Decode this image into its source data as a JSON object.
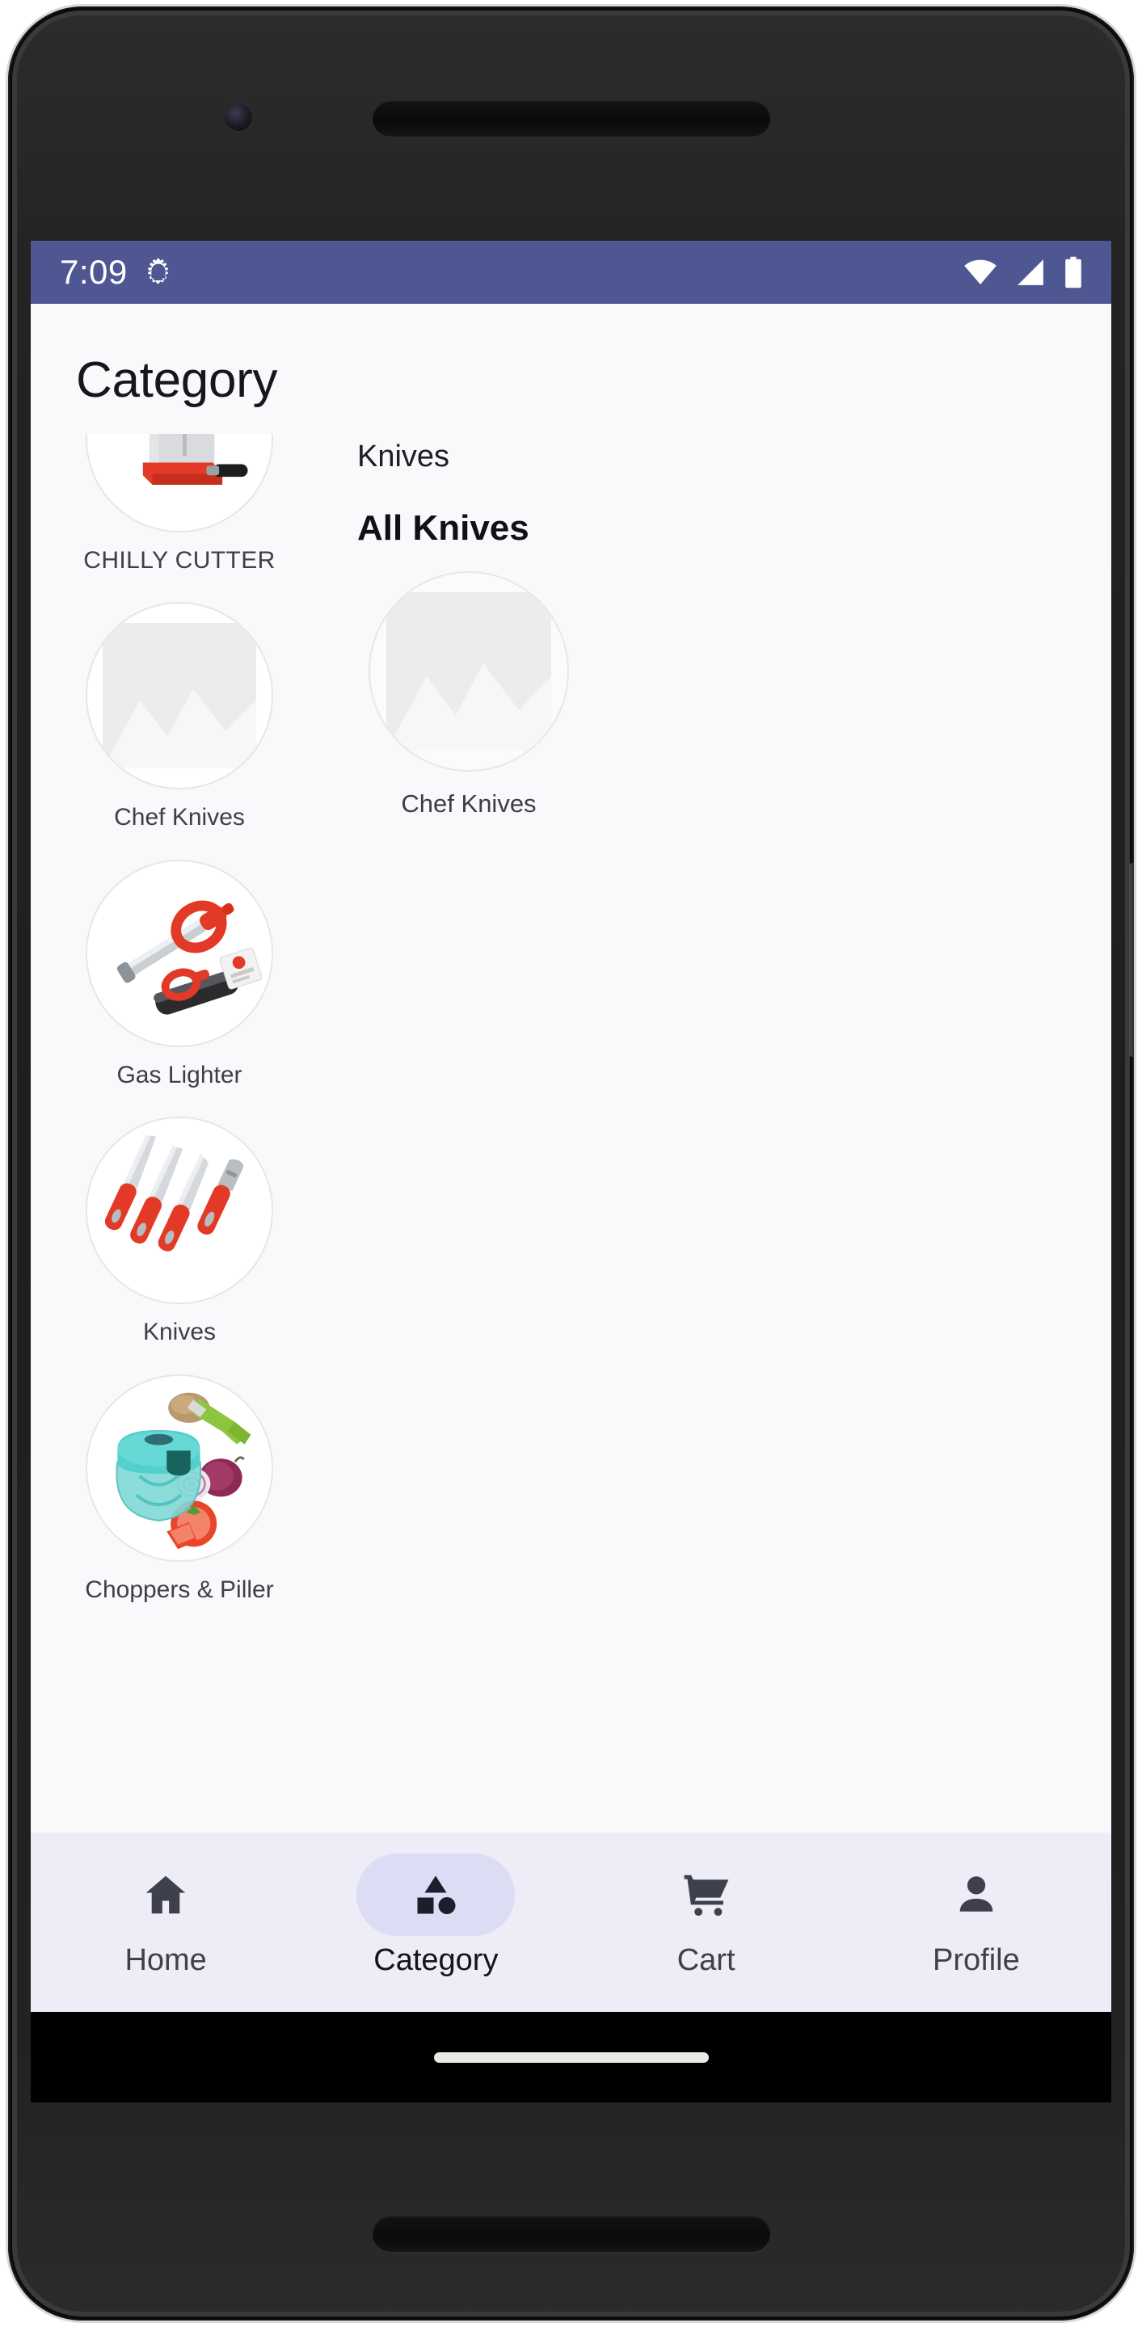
{
  "device": {
    "front_camera_icon": "camera-icon",
    "earpiece_icon": "speaker-grille-icon",
    "side_button_icon": "power-button-icon"
  },
  "status_bar": {
    "time": "7:09",
    "debug_icon": "bug-gear-icon",
    "wifi_icon": "wifi-icon",
    "signal_icon": "cell-signal-icon",
    "battery_icon": "battery-icon",
    "background_color": "#4f5793",
    "foreground_color": "#ffffff"
  },
  "header": {
    "title": "Category"
  },
  "category_rail": {
    "items": [
      {
        "label": "CHILLY CUTTER",
        "image": "chilly-cutter-photo",
        "uppercase": true,
        "partially_scrolled": true
      },
      {
        "label": "Chef Knives",
        "image": "image-placeholder",
        "uppercase": false
      },
      {
        "label": "Gas Lighter",
        "image": "gas-lighter-photo",
        "uppercase": false
      },
      {
        "label": "Knives",
        "image": "knives-photo",
        "uppercase": false
      },
      {
        "label": "Choppers & Piller",
        "image": "chopper-photo",
        "uppercase": false
      }
    ]
  },
  "detail_panel": {
    "breadcrumb": "Knives",
    "heading": "All Knives",
    "products": [
      {
        "label": "Chef Knives",
        "image": "image-placeholder"
      }
    ]
  },
  "bottom_nav": {
    "active_index": 1,
    "active_pill_color": "#dcdcf5",
    "background_color": "#edecf7",
    "items": [
      {
        "label": "Home",
        "icon": "home-icon"
      },
      {
        "label": "Category",
        "icon": "category-shapes-icon"
      },
      {
        "label": "Cart",
        "icon": "shopping-cart-icon"
      },
      {
        "label": "Profile",
        "icon": "person-icon"
      }
    ]
  },
  "gesture_bar": {
    "home_indicator_icon": "home-indicator"
  }
}
